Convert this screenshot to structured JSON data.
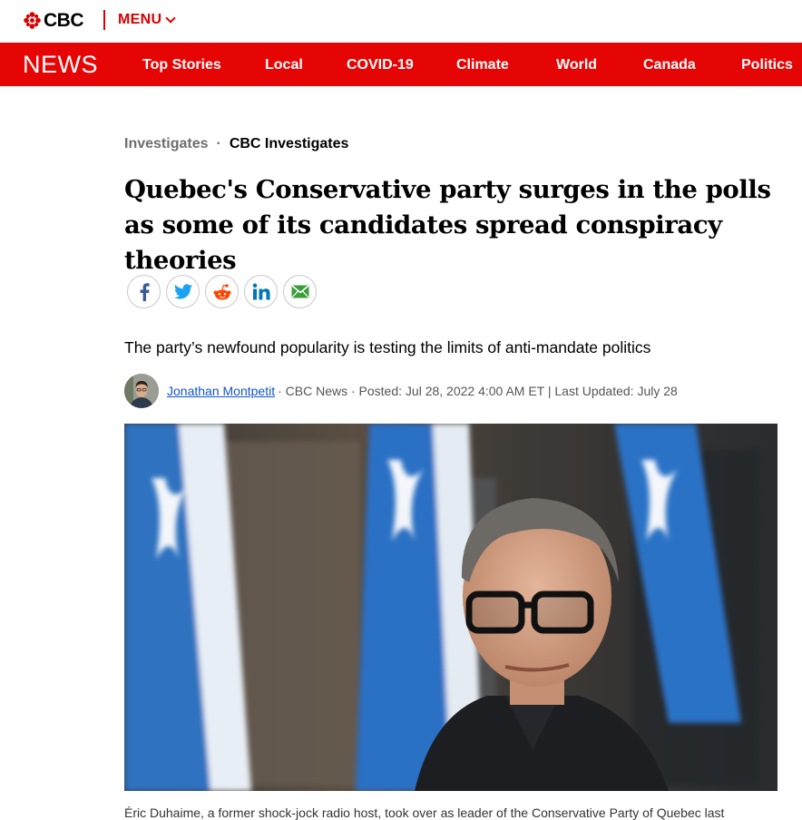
{
  "header": {
    "brand": "CBC",
    "menu_label": "MENU"
  },
  "nav": {
    "section_logo": "NEWS",
    "items": [
      {
        "label": "Top Stories"
      },
      {
        "label": "Local"
      },
      {
        "label": "COVID-19"
      },
      {
        "label": "Climate"
      },
      {
        "label": "World"
      },
      {
        "label": "Canada"
      },
      {
        "label": "Politics"
      }
    ]
  },
  "colors": {
    "brand_red": "#e60505",
    "link_blue": "#1155cc"
  },
  "article": {
    "breadcrumb": [
      "Investigates",
      "CBC Investigates"
    ],
    "breadcrumb_separator": "·",
    "headline": "Quebec's Conservative party surges in the polls as some of its candidates spread conspiracy theories",
    "share_icons": [
      "facebook-icon",
      "twitter-icon",
      "reddit-icon",
      "linkedin-icon",
      "email-icon"
    ],
    "deck": "The party’s newfound popularity is testing the limits of anti-mandate politics",
    "author": "Jonathan Montpetit",
    "meta": "· CBC News · Posted: Jul 28, 2022 4:00 AM ET | Last Updated: July 28",
    "caption": "Éric Duhaime, a former shock-jock radio host, took over as leader of the Conservative Party of Quebec last"
  }
}
